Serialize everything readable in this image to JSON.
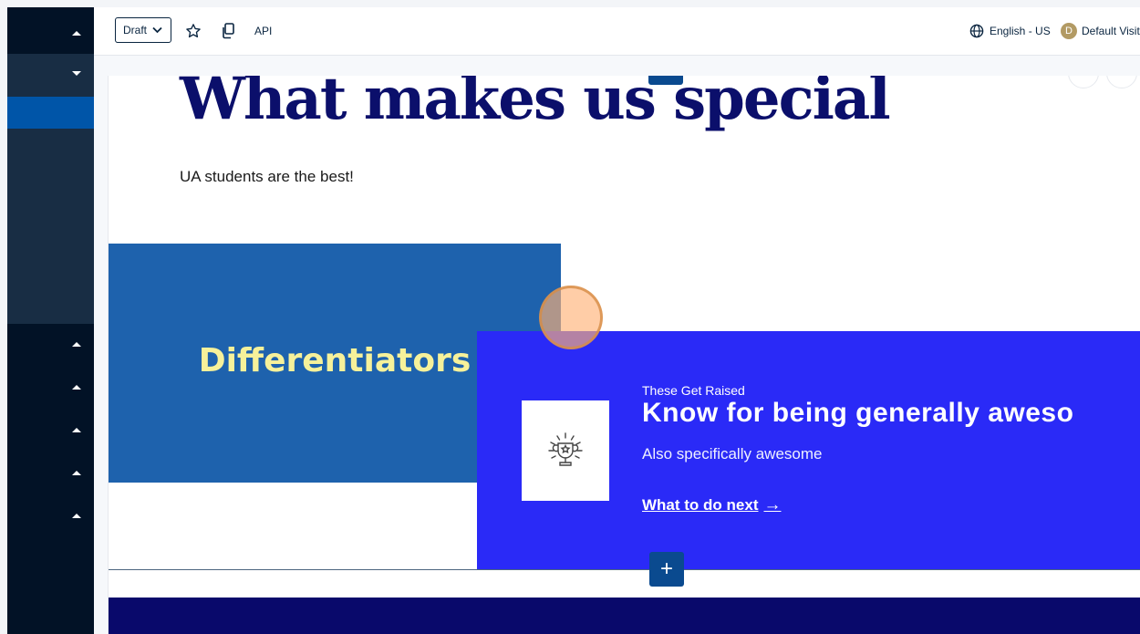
{
  "toolbar": {
    "status_select": "Draft",
    "api_label": "API",
    "language": "English - US",
    "visitor_initial": "D",
    "visitor": "Default Visito"
  },
  "hero": {
    "title": "What makes us special",
    "subtitle": "UA students are the best!"
  },
  "differentiators": {
    "label": "Differentiators"
  },
  "card": {
    "eyebrow": "These Get Raised",
    "heading": "Know for being generally aweso",
    "description": "Also specifically awesome",
    "link_text": "What to do next",
    "link_arrow": "→"
  },
  "add_button": "+",
  "colors": {
    "sidebar": "#021226",
    "sidebar_panel": "#182d44",
    "sidebar_active": "#0055a8",
    "title": "#0b0f6b",
    "diff_block": "#1e62ad",
    "diff_text": "#f6f19a",
    "card": "#2a2af7",
    "add_button": "#0a4a8f",
    "footer_band": "#09096b"
  },
  "icons": [
    "caret-up-icon",
    "caret-down-icon",
    "chevron-down-icon",
    "star-icon",
    "copy-icon",
    "globe-icon",
    "trophy-icon",
    "arrow-right-icon"
  ]
}
